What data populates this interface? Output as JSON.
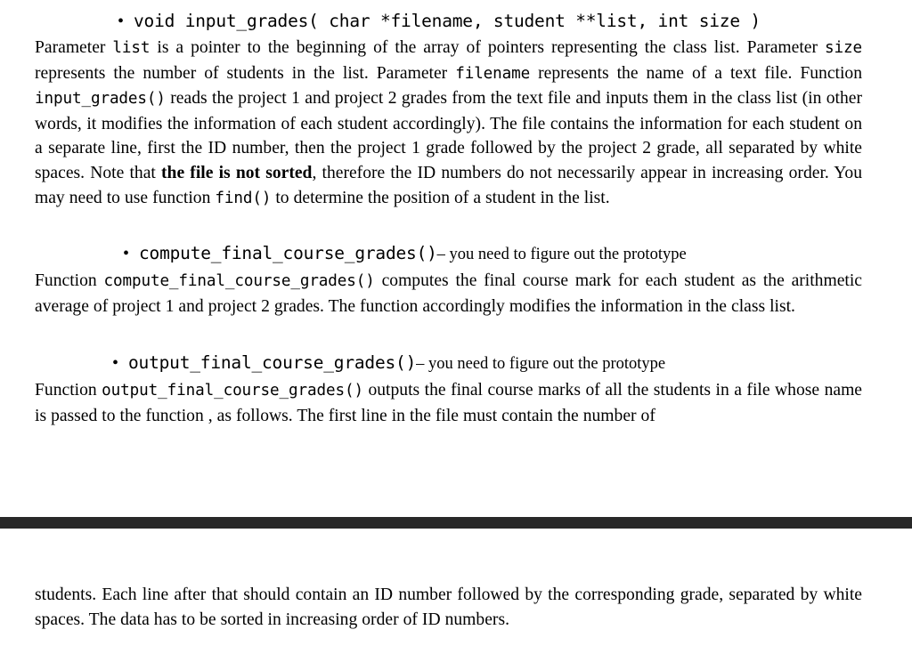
{
  "document": {
    "kind": "pdf-page-view",
    "background_color": "#ffffff",
    "text_color": "#000000",
    "page_separator_color": "#282828"
  },
  "page_top": {
    "bullets": [
      {
        "id": "input-grades",
        "dot": "•",
        "signature": "void input_grades( char *filename, student **list, int size )",
        "tail": ""
      },
      {
        "id": "compute-final-course-grades",
        "dot": "•",
        "signature": "compute_final_course_grades()",
        "tail": "–  you need to figure out the prototype"
      },
      {
        "id": "output-final-course-grades",
        "dot": "•",
        "signature": "output_final_course_grades()",
        "tail": "–  you need to figure out the prototype"
      }
    ],
    "paragraph_1": {
      "seg_1": "Parameter ",
      "code_1": "list",
      "seg_2": " is a pointer to the beginning of the array of pointers representing the class list. Parameter ",
      "code_2": "size",
      "seg_3": " represents the number of students in the list. Parameter ",
      "code_3": "filename",
      "seg_4": "  represents the name of a text file. Function ",
      "code_4": "input_grades()",
      "seg_5": " reads the project 1 and project 2 grades from the text file and inputs them in the class list (in other words, it modifies the information of each student accordingly). The file contains the information for each student on a separate line, first the ID number, then the project 1 grade followed by the project 2 grade, all separated by white spaces. Note that ",
      "bold_1": "the file is not sorted",
      "seg_6": ", therefore the ID numbers do not necessarily appear in increasing order. You may need to use function ",
      "code_5": "find()",
      "seg_7": "  to determine the position of a student in the list."
    },
    "paragraph_2": {
      "seg_1": "Function ",
      "code_1": "compute_final_course_grades()",
      "seg_2": " computes the final course mark for each student as the arithmetic average of project 1 and project 2 grades. The function accordingly modifies the information in the class list."
    },
    "paragraph_3": {
      "seg_1": "Function ",
      "code_1": "output_final_course_grades()",
      "seg_2": " outputs the final course marks of all the students in a file  whose name is passed to the function , as follows. The first line in the file must contain the number of"
    }
  },
  "page_bottom": {
    "paragraph_1": {
      "text": "students. Each line after that should contain an ID number followed by the corresponding grade, separated by white spaces. The data has to be sorted in increasing order of ID numbers."
    }
  }
}
